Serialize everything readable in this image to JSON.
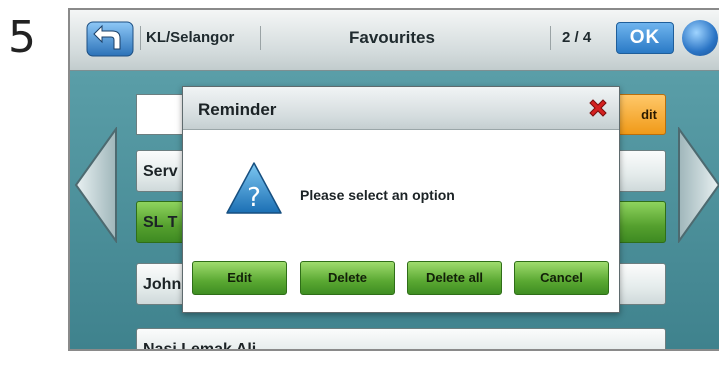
{
  "step_number": "5",
  "topbar": {
    "region": "KL/Selangor",
    "title": "Favourites",
    "pager": "2 / 4",
    "ok_label": "OK",
    "back_icon": "u-turn-back-icon",
    "globe_icon": "globe-icon"
  },
  "list": {
    "edit_label": "dit",
    "items": [
      {
        "label": "Serv",
        "selected": false
      },
      {
        "label": "SL T",
        "selected": true
      },
      {
        "label": "John",
        "selected": false
      },
      {
        "label": "Nasi Lemak Ali",
        "selected": false
      }
    ]
  },
  "dialog": {
    "title": "Reminder",
    "message": "Please select an option",
    "buttons": [
      "Edit",
      "Delete",
      "Delete all",
      "Cancel"
    ],
    "icon": "question-icon",
    "close_icon": "close-icon"
  },
  "colors": {
    "accent_green": "#55a02e",
    "ok_blue": "#2a7ac6",
    "edit_orange": "#f09a18",
    "close_red": "#d42020",
    "content_bg": "#4a8f9a"
  }
}
